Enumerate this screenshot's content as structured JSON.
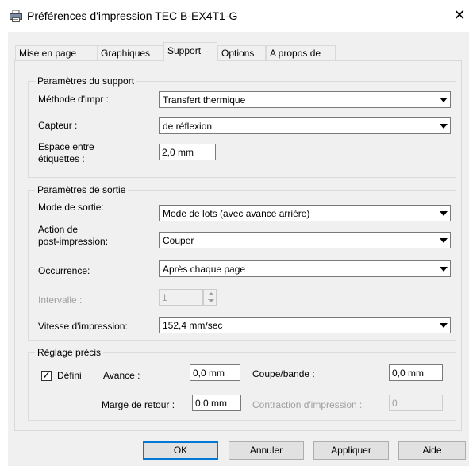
{
  "window": {
    "title": "Préférences d'impression TEC B-EX4T1-G",
    "close_glyph": "✕"
  },
  "tabs": [
    {
      "label": "Mise en page"
    },
    {
      "label": "Graphiques"
    },
    {
      "label": "Support"
    },
    {
      "label": "Options"
    },
    {
      "label": "A propos de"
    }
  ],
  "media_settings": {
    "group_title": "Paramètres du support",
    "print_method": {
      "label": "Méthode d'impr :",
      "value": "Transfert thermique"
    },
    "sensor": {
      "label": "Capteur :",
      "value": "de réflexion"
    },
    "label_gap": {
      "label_line1": "Espace entre",
      "label_line2": "étiquettes :",
      "value": "2,0 mm"
    }
  },
  "output_settings": {
    "group_title": "Paramètres de sortie",
    "output_mode": {
      "label": "Mode de sortie:",
      "value": "Mode de lots (avec avance arrière)"
    },
    "post_print_action": {
      "label_line1": "Action de",
      "label_line2": "post-impression:",
      "value": "Couper"
    },
    "occurrence": {
      "label": "Occurrence:",
      "value": "Après chaque page"
    },
    "interval": {
      "label": "Intervalle :",
      "value": "1"
    },
    "print_speed": {
      "label": "Vitesse d'impression:",
      "value": "152,4 mm/sec"
    }
  },
  "fine_adjust": {
    "group_title": "Réglage précis",
    "defined": {
      "label": "Défini",
      "checked": true,
      "check_glyph": "✓"
    },
    "feed": {
      "label": "Avance :",
      "value": "0,0 mm"
    },
    "cut_strip": {
      "label": "Coupe/bande :",
      "value": "0,0 mm"
    },
    "backfeed_margin": {
      "label": "Marge de retour :",
      "value": "0,0 mm"
    },
    "print_contraction": {
      "label": "Contraction d'impression :",
      "value": "0"
    }
  },
  "buttons": {
    "ok": "OK",
    "cancel": "Annuler",
    "apply": "Appliquer",
    "help": "Aide"
  },
  "colors": {
    "accent": "#0078d7",
    "dialog_bg": "#f0f0f0",
    "disabled_text": "#a0a0a0"
  }
}
